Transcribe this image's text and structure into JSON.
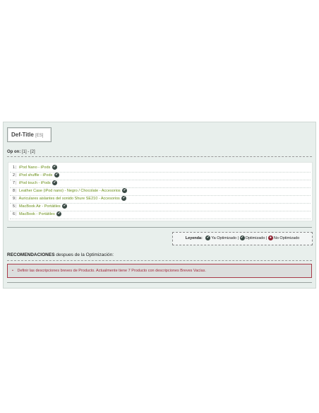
{
  "panel": {
    "title": "Def-Title",
    "lang": "[ES]",
    "pager": {
      "label": "Op on:",
      "page1": "[1]",
      "sep": "-",
      "page2": "[2]"
    }
  },
  "products": [
    {
      "num": "1",
      "name": "iPod Nano - iPods"
    },
    {
      "num": "2",
      "name": "iPod shuffle - iPods"
    },
    {
      "num": "7",
      "name": "iPod touch - iPods"
    },
    {
      "num": "8",
      "name": "Leather Case (iPod nano) - Negro / Chocolate - Accesorios"
    },
    {
      "num": "9",
      "name": "Auriculares aislantes del sonido Shure SE210 - Accesorios"
    },
    {
      "num": "5",
      "name": "MacBook Air - Portátiles"
    },
    {
      "num": "6",
      "name": "MacBook - Portátiles"
    }
  ],
  "legend": {
    "label": "Leyenda:",
    "ya": "Ya Optimizado |",
    "opt": "Optimizado |",
    "no": "No Optimizado"
  },
  "recommendations": {
    "title_bold": "RECOMENDACIONES",
    "title_rest": " despues de la Optimización:",
    "alert": "Definir las descripciones breves de Producto. Actualmente tiene 7 Producto con descripciones Breves Vacías."
  },
  "colors": {
    "link_green": "#6a8f1a",
    "alert_red": "#a0283a",
    "panel_bg": "#e8efec"
  }
}
